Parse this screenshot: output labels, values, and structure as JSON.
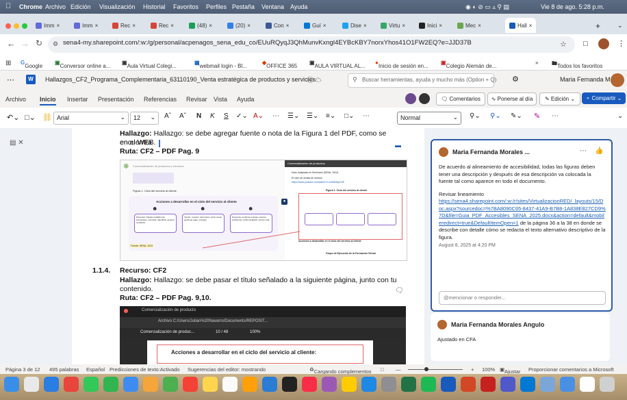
{
  "menubar": {
    "apple": "",
    "items": [
      "Chrome",
      "Archivo",
      "Edición",
      "Visualización",
      "Historial",
      "Favoritos",
      "Perfiles",
      "Pestaña",
      "Ventana",
      "Ayuda"
    ],
    "clock": "Vie 8 de ago.  5:28 p.m."
  },
  "tabs": [
    {
      "label": "Imm",
      "color": "#5f6bd8"
    },
    {
      "label": "Imm",
      "color": "#5f6bd8"
    },
    {
      "label": "Rec",
      "color": "#d44638"
    },
    {
      "label": "Rec",
      "color": "#d44638"
    },
    {
      "label": "(48)",
      "color": "#1a9e5b"
    },
    {
      "label": "(20)",
      "color": "#2f80ed"
    },
    {
      "label": "Con",
      "color": "#3b5998"
    },
    {
      "label": "Guí",
      "color": "#0078d4"
    },
    {
      "label": "Dise",
      "color": "#1da1f2"
    },
    {
      "label": "Virtu",
      "color": "#37a567"
    },
    {
      "label": "Inici",
      "color": "#222"
    },
    {
      "label": "Mec",
      "color": "#6aa84f"
    },
    {
      "label": "Hall",
      "color": "#185abd"
    }
  ],
  "address": {
    "url": "sena4-my.sharepoint.com/:w:/g/personal/acpenagos_sena_edu_co/EUuRQyqJ3QhMunvKxngl4EYBcKBY7norxYhos41O1FW2EQ?e=JJD37B"
  },
  "bookmarks": [
    "Google",
    "Conversor online a...",
    "Aula Virtual Colegi...",
    "webmail login - Bl...",
    "OFFICE 365",
    "AULA VIRTUAL AL...",
    "Inicio de sesión en...",
    "Colegio Alemán de..."
  ],
  "bookmarks_right": "Todos los favoritos",
  "word": {
    "doc_title": "Hallazgos_CF2_Programa_Complementaria_63110190_Venta estratégica de productos y servicios",
    "search_placeholder": "Buscar herramientas, ayuda y mucho más (Option + Q)",
    "user": "Maria Fernanda M...",
    "ribbon_tabs": [
      "Archivo",
      "Inicio",
      "Insertar",
      "Presentación",
      "Referencias",
      "Revisar",
      "Vista",
      "Ayuda"
    ],
    "comments_btn": "Comentarios",
    "catchup_btn": "Ponerse al día",
    "edit_btn": "Edición",
    "share_btn": "Compartir",
    "font": "Arial",
    "font_size": "12",
    "style": "Normal"
  },
  "doc": {
    "p1_line1": "Hallazgo: se debe agregar fuente o nota de la Figura 1 del PDF, como se encuentra",
    "p1_line2": "en el WEB.",
    "ruta1": "Ruta: CF2 – PDF Pag. 9",
    "sec_num": "1.1.4.",
    "sec_title": "Recurso: CF2",
    "p2_line1": "Hallazgo: se debe pasar el título señalado a la siguiente página, junto con tu",
    "p2_line2": "contenido.",
    "ruta2": "Ruta: CF2 – PDF Pag. 9,10.",
    "img1": {
      "left_header": "Comercialización de productos y servicios",
      "figure_label": "Figura 1.   Ciclo del servicio al cliente",
      "actions_title": "Acciones a desarrollar en el ciclo del servicio al cliente",
      "box1": "Presentar: Saluda cordialmente, presentarse, escuchar, identificar, generar confianza.",
      "box2": "Vender: resolver, demostrar, cerrar venta, gestionar pago, entregar.",
      "box3": "Posventa: confirmar entrega, resolver problemas, recibir feedback, ofrecer más.",
      "source_tag": "Fuente: SENA, 2024",
      "right_tab": "Comercialización de productos",
      "right_nota": "Nota. Adaptada en Seminario (SENA, 2024)",
      "right_text": "El ciclo de ventas de servicio",
      "right_link": "https://www.youtube.com/watch?v=hm0t43iqGOE",
      "right_fig": "Figura 1.  Ciclo del servicio al cliente",
      "right_bottom": "Acciones a desarrollar en el ciclo del servicio al cliente",
      "right_footer": "Grupo de Ejecución de la Formación Virtual"
    },
    "img2": {
      "tab": "Comercialización de producto",
      "file_url": "Archivo   C:/Users/Julian%20Navarro/Documents/REPOSIT...",
      "inner_title": "Comercialización de produc...",
      "page": "10 / 48",
      "zoom": "100%",
      "heading": "Acciones a desarrollar en el  ciclo del servicio al cliente:"
    }
  },
  "comments": {
    "c1_author": "Maria Fernanda Morales ...",
    "c1_text": "De acuerdo al alineamiento de accesibilidad, todas las figuras deben tener una descripción y después de esa descripción va colocada la fuente tal como aparece en todo el documento.",
    "c1_text2": "Revisar lineamiento",
    "c1_link": "https://sena4.sharepoint.com/:w:/r/sites/VirtualizacionRED/_layouts/15/Doc.aspx?sourcedoc=%7BA8090C65-8437-41A9-B7B8-1A838E827CD9%7D&file=Guia_PDF_Accesibles_SENA_2025.docx&action=default&mobileredirect=true&DefaultItemOpen=1",
    "c1_text3": " de la página 36 a la 38 en donde se describe con detalle cómo se redacta el texto alternativo descriptivo de la figura.",
    "c1_date": "August 8, 2025 at 4:20 PM",
    "c1_reply": "@mencionar o responder...",
    "c2_author": "Maria Fernanda Morales Angulo",
    "c2_text": "Ajustado en CFA"
  },
  "status": {
    "page": "Página 3 de 12",
    "words": "495 palabras",
    "lang": "Español",
    "predict": "Predicciones de texto:Activado",
    "suggest": "Sugerencias del editor: mostrando",
    "loading": "Cargando complementos",
    "zoom": "100%",
    "fit": "Ajustar",
    "feedback": "Proporcionar comentarios a Microsoft"
  },
  "colors": {
    "accent": "#185abd",
    "comment_border": "#2f5aa8",
    "link": "#1a5fb4",
    "highlight_red": "#e06666"
  },
  "dock_icons": [
    "finder-icon",
    "launchpad-icon",
    "safari-icon",
    "chrome-icon",
    "messages-icon",
    "facetime-icon",
    "mail-icon",
    "photos-icon",
    "maps-icon",
    "calendar-icon",
    "notes-icon",
    "reminders-icon",
    "pages-icon",
    "keynote-icon",
    "appletv-icon",
    "music-icon",
    "podcasts-icon",
    "freeform-icon",
    "appstore-icon",
    "systemsettings-icon",
    "excel-icon",
    "spotify-icon",
    "word-icon",
    "powerpoint-icon",
    "acrobat-icon",
    "teams-icon",
    "outlook-icon",
    "preview-icon",
    "finder2-icon",
    "screens-icon",
    "trash-icon"
  ]
}
